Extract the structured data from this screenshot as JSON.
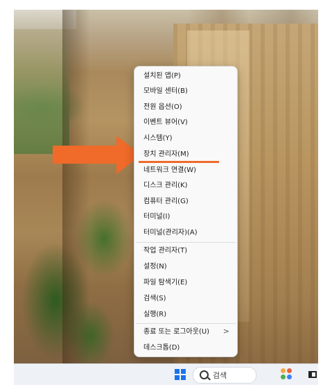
{
  "context_menu": {
    "items": [
      {
        "label": "설치된 앱(P)"
      },
      {
        "label": "모바일 센터(B)"
      },
      {
        "label": "전원 옵션(O)"
      },
      {
        "label": "이벤트 뷰어(V)"
      },
      {
        "label": "시스템(Y)"
      },
      {
        "label": "장치 관리자(M)",
        "highlighted": true
      },
      {
        "label": "네트워크 연결(W)"
      },
      {
        "label": "디스크 관리(K)"
      },
      {
        "label": "컴퓨터 관리(G)"
      },
      {
        "label": "터미널(I)"
      },
      {
        "label": "터미널(관리자)(A)"
      },
      {
        "label": "작업 관리자(T)"
      },
      {
        "label": "설정(N)"
      },
      {
        "label": "파일 탐색기(E)"
      },
      {
        "label": "검색(S)"
      },
      {
        "label": "실행(R)"
      },
      {
        "label": "종료 또는 로그아웃(U)",
        "submenu": ">"
      },
      {
        "label": "데스크톱(D)"
      }
    ]
  },
  "taskbar": {
    "search_label": "검색"
  },
  "colors": {
    "annotation": "#f06a2a",
    "start_icon": "#1a73e8"
  }
}
